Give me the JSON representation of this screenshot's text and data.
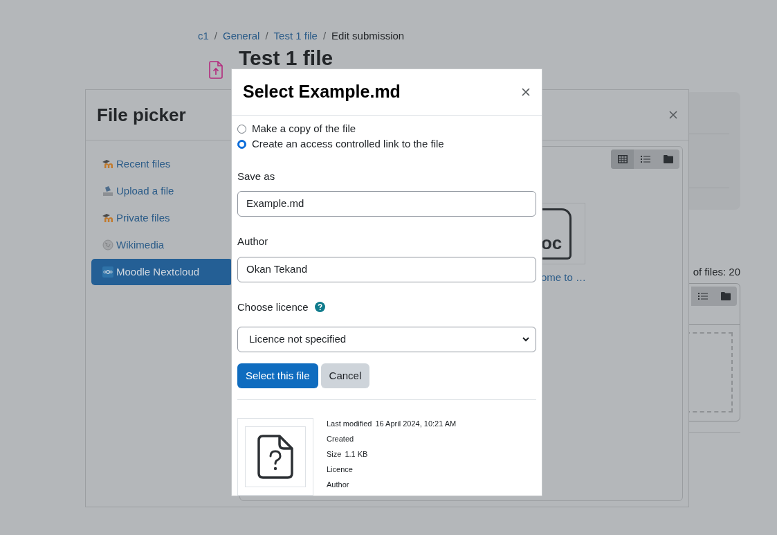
{
  "breadcrumb": [
    {
      "label": "c1",
      "link": true
    },
    {
      "separator": "/",
      "label": "General",
      "link": true
    },
    {
      "separator": "/",
      "label": "Test 1 file",
      "link": true
    },
    {
      "separator": "/",
      "label": "Edit submission",
      "link": false
    }
  ],
  "page": {
    "title": "Test 1 file",
    "files_count": "of files: 20"
  },
  "file_picker": {
    "title": "File picker",
    "repositories": [
      {
        "label": "Recent files",
        "kind": "moodle",
        "selected": false
      },
      {
        "label": "Upload a file",
        "kind": "upload",
        "selected": false
      },
      {
        "label": "Private files",
        "kind": "moodle",
        "selected": false
      },
      {
        "label": "Wikimedia",
        "kind": "wikimedia",
        "selected": false
      },
      {
        "label": "Moodle Nextcloud",
        "kind": "nextcloud",
        "selected": true
      }
    ],
    "view_modes": [
      {
        "kind": "icons",
        "selected": true
      },
      {
        "kind": "list",
        "selected": false
      },
      {
        "kind": "tree",
        "selected": false
      }
    ],
    "files": [
      {
        "icon_text": "oc",
        "name": "ome to …"
      }
    ]
  },
  "dialog": {
    "title": "Select Example.md",
    "options": [
      {
        "label": "Make a copy of the file",
        "selected": false
      },
      {
        "label": "Create an access controlled link to the file",
        "selected": true
      }
    ],
    "save_as": {
      "label": "Save as",
      "value": "Example.md"
    },
    "author": {
      "label": "Author",
      "value": "Okan Tekand"
    },
    "licence": {
      "label": "Choose licence",
      "value": "Licence not specified"
    },
    "buttons": [
      {
        "label": "Select this file",
        "kind": "primary"
      },
      {
        "label": "Cancel",
        "kind": "secondary"
      }
    ],
    "details": [
      {
        "label": "Last modified",
        "value": "16 April 2024, 10:21 AM"
      },
      {
        "label": "Created"
      },
      {
        "label": "Size",
        "value": "1.1 KB"
      },
      {
        "label": "Licence"
      },
      {
        "label": "Author"
      }
    ]
  }
}
